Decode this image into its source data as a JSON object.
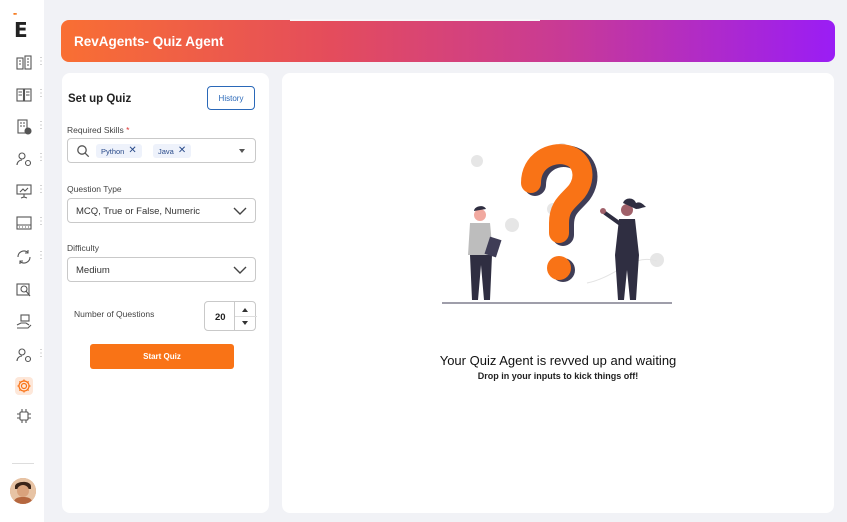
{
  "app": {
    "logo_letter": "E",
    "brand_color": "#f97316"
  },
  "sidebar": {
    "items": [
      {
        "icon": "building-icon",
        "has_menu": true
      },
      {
        "icon": "book-open-icon",
        "has_menu": true
      },
      {
        "icon": "office-settings-icon",
        "has_menu": true
      },
      {
        "icon": "user-settings-icon",
        "has_menu": true
      },
      {
        "icon": "presentation-chart-icon",
        "has_menu": true
      },
      {
        "icon": "server-rack-icon",
        "has_menu": true
      },
      {
        "icon": "refresh-hand-icon",
        "has_menu": true
      },
      {
        "icon": "document-search-icon",
        "has_menu": false
      },
      {
        "icon": "hand-coin-icon",
        "has_menu": false
      },
      {
        "icon": "user-gear-icon",
        "has_menu": true
      },
      {
        "icon": "gear-icon",
        "has_menu": false,
        "active": true
      },
      {
        "icon": "brain-chip-icon",
        "has_menu": false
      }
    ]
  },
  "header": {
    "title": "RevAgents- Quiz Agent"
  },
  "setup": {
    "title": "Set up Quiz",
    "history_label": "History",
    "skills": {
      "label": "Required Skills",
      "required_mark": "*",
      "chips": [
        "Python",
        "Java"
      ],
      "chip_remove": "✕"
    },
    "question_type": {
      "label": "Question Type",
      "value": "MCQ, True or False, Numeric"
    },
    "difficulty": {
      "label": "Difficulty",
      "value": "Medium"
    },
    "num_questions": {
      "label": "Number of Questions",
      "value": "20"
    },
    "start_label": "Start Quiz"
  },
  "empty_state": {
    "title": "Your Quiz Agent is revved up and waiting",
    "subtitle": "Drop in your inputs to kick things off!"
  }
}
